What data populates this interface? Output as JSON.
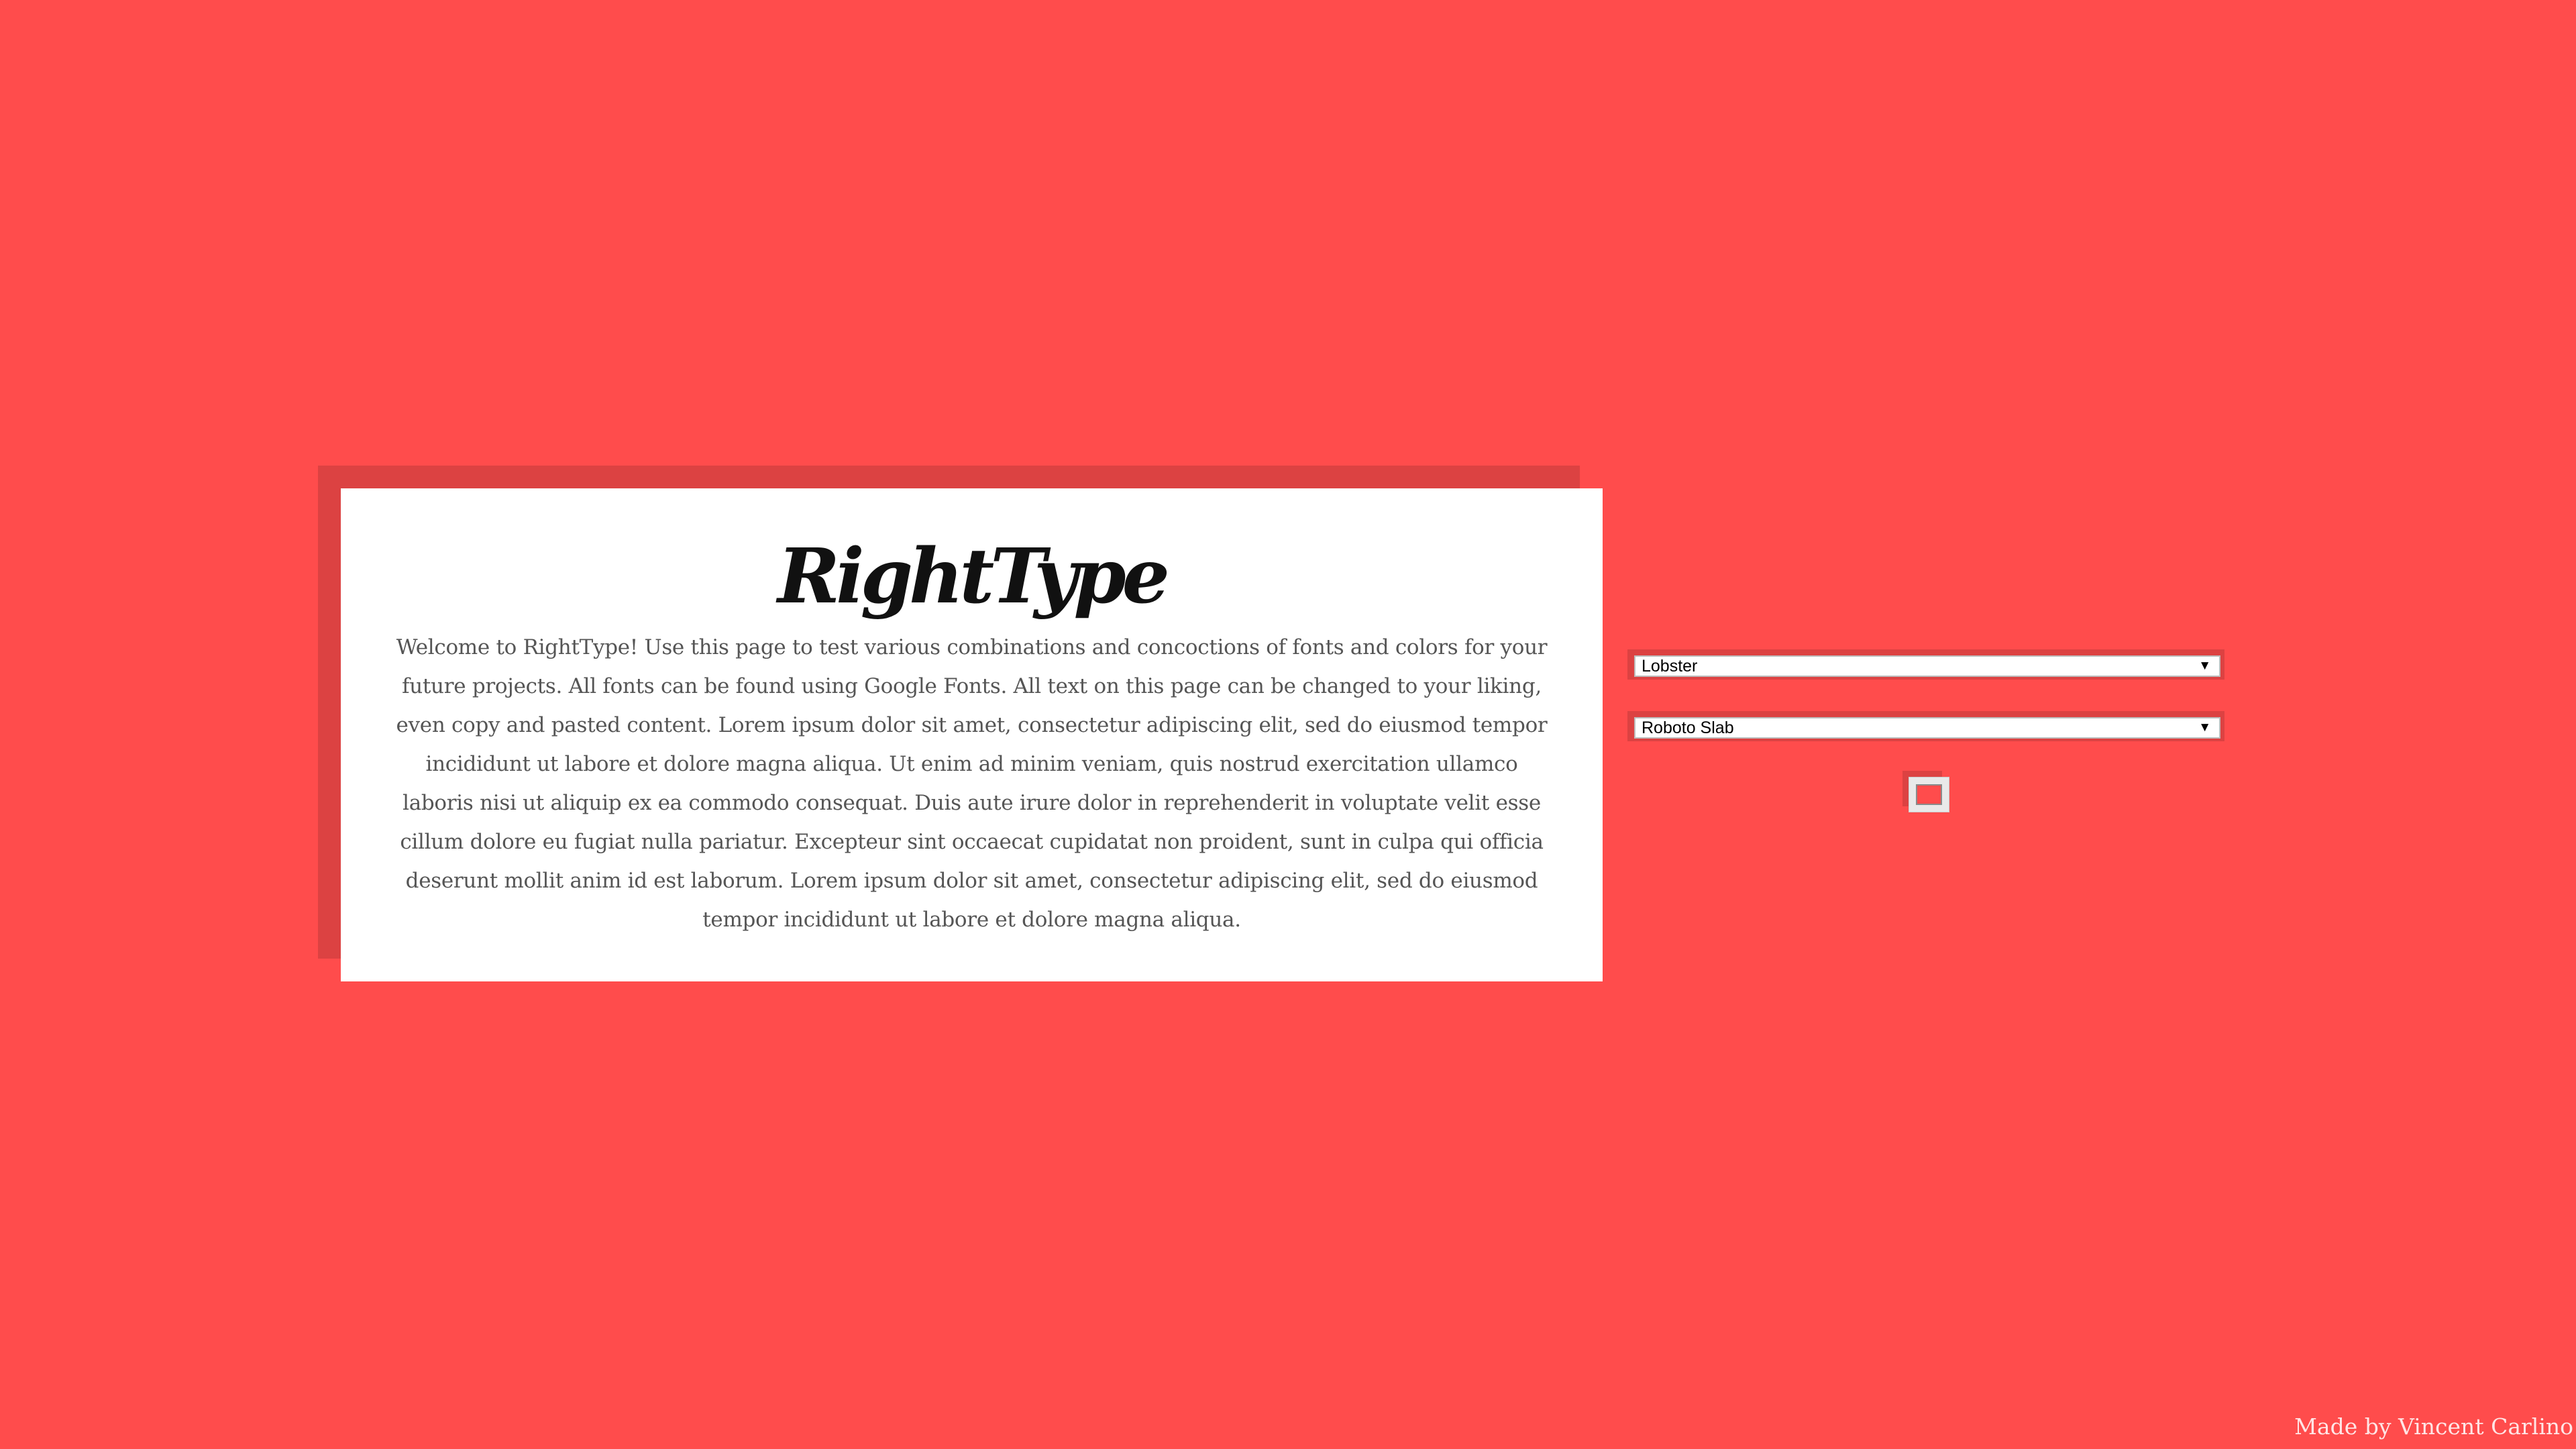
{
  "card": {
    "title": "RightType",
    "body": "Welcome to RightType! Use this page to test various combinations and concoctions of fonts and colors for your future projects. All fonts can be found using Google Fonts. All text on this page can be changed to your liking, even copy and pasted content. Lorem ipsum dolor sit amet, consectetur adipiscing elit, sed do eiusmod tempor incididunt ut labore et dolore magna aliqua. Ut enim ad minim veniam, quis nostrud exercitation ullamco laboris nisi ut aliquip ex ea commodo consequat. Duis aute irure dolor in reprehenderit in voluptate velit esse cillum dolore eu fugiat nulla pariatur. Excepteur sint occaecat cupidatat non proident, sunt in culpa qui officia deserunt mollit anim id est laborum. Lorem ipsum dolor sit amet, consectetur adipiscing elit, sed do eiusmod tempor incididunt ut labore et dolore magna aliqua."
  },
  "controls": {
    "heading_font": {
      "selected": "Lobster",
      "arrow_icon": "dropdown-arrow-icon"
    },
    "body_font": {
      "selected": "Roboto Slab",
      "arrow_icon": "dropdown-arrow-icon"
    },
    "color_picker": {
      "value": "#ff4c4c"
    }
  },
  "footer": {
    "credit": "Made by Vincent Carlino"
  },
  "colors": {
    "background": "#ff4c4c",
    "accent_shadow": "#dc4242",
    "card": "#ffffff"
  }
}
